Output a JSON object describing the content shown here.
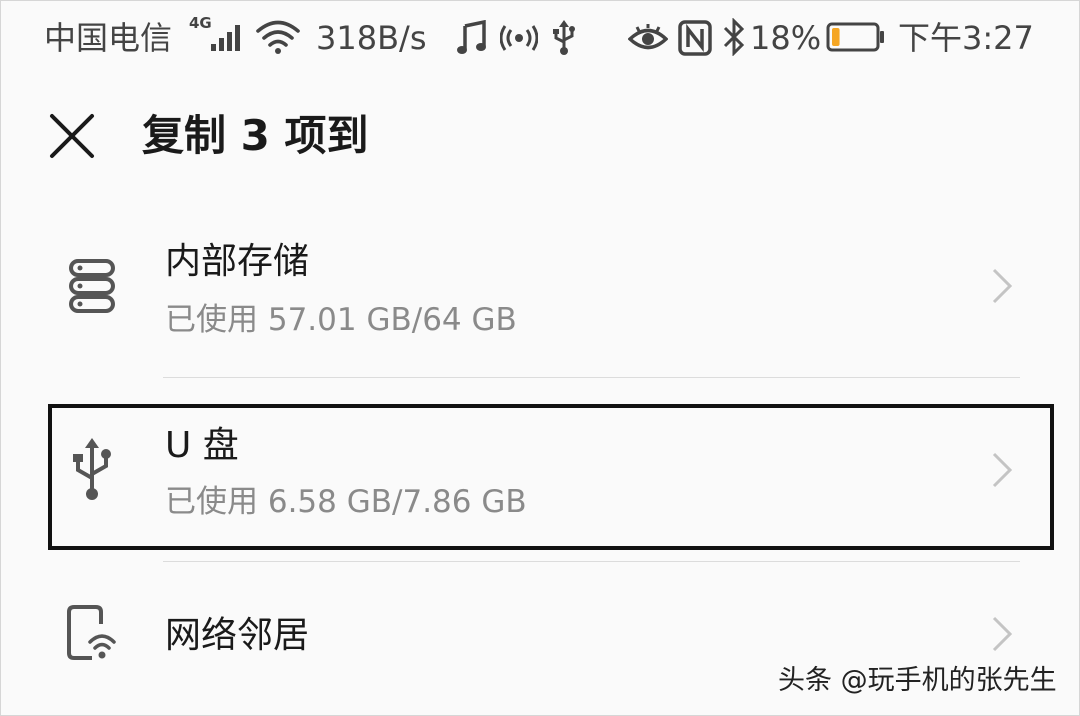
{
  "status_bar": {
    "carrier": "中国电信",
    "network": "4G",
    "speed": "318B/s",
    "battery": "18%",
    "time": "下午3:27",
    "battery_color": "#f5a623",
    "icons": [
      "signal-icon",
      "wifi-icon",
      "music-icon",
      "hotspot-icon",
      "usb-icon",
      "eye-icon",
      "nfc-icon",
      "bluetooth-icon",
      "battery-icon"
    ]
  },
  "header": {
    "title": "复制 3 项到",
    "close_icon": "close-icon"
  },
  "locations": [
    {
      "icon": "storage-icon",
      "title": "内部存储",
      "subtitle": "已使用 57.01 GB/64 GB"
    },
    {
      "icon": "usb-icon",
      "title": "U 盘",
      "subtitle": "已使用 6.58 GB/7.86 GB"
    },
    {
      "icon": "network-neighborhood-icon",
      "title": "网络邻居"
    }
  ],
  "watermark": "头条 @玩手机的张先生",
  "colors": {
    "background": "#fafafa",
    "primary_text": "#1a1a1a",
    "secondary_text": "#8a8a8a",
    "chevron": "#c4c4c4",
    "highlight_border": "#111111"
  }
}
